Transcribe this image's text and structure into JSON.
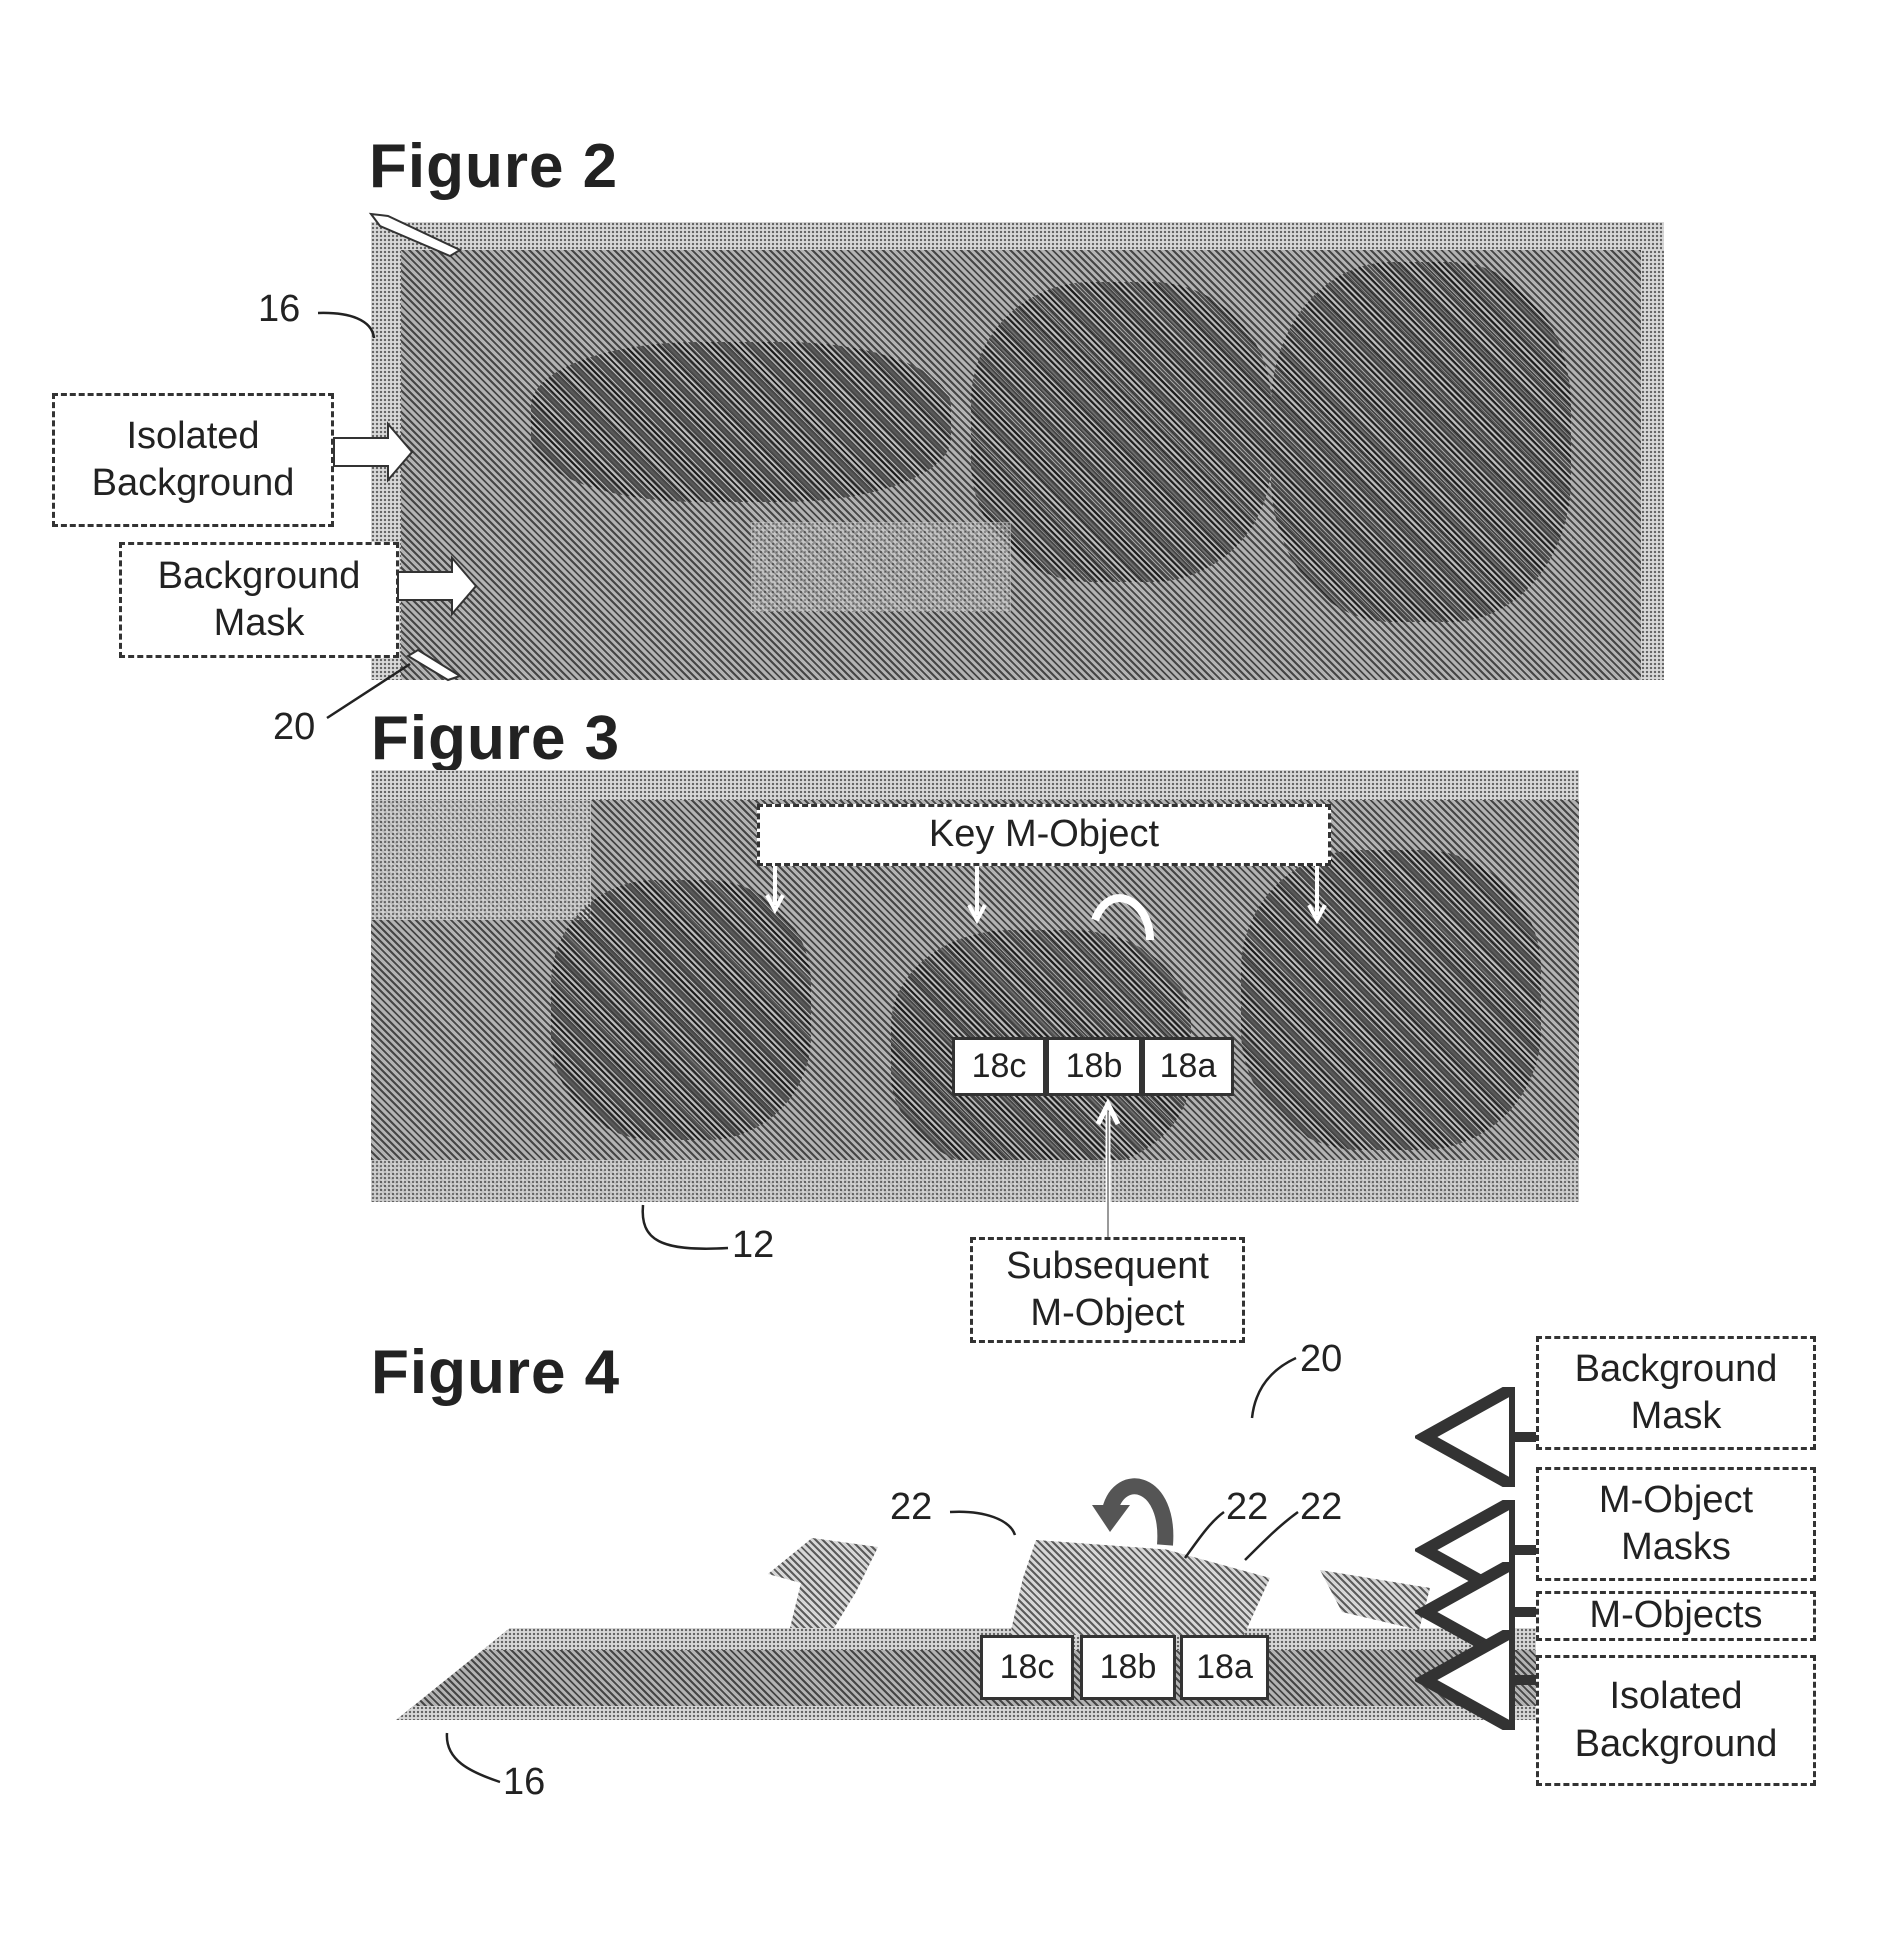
{
  "figure2": {
    "title": "Figure 2",
    "labels": {
      "isolated_background": "Isolated\nBackground",
      "background_mask": "Background\nMask"
    },
    "refs": {
      "layer": "16",
      "mask": "20"
    }
  },
  "figure3": {
    "title": "Figure 3",
    "key_object_label": "Key M-Object",
    "subsequent_object_label": "Subsequent\nM-Object",
    "objects": [
      "18c",
      "18b",
      "18a"
    ],
    "refs": {
      "frame": "12"
    }
  },
  "figure4": {
    "title": "Figure 4",
    "layer_labels": [
      "Background\nMask",
      "M-Object\nMasks",
      "M-Objects",
      "Isolated\nBackground"
    ],
    "objects": [
      "18c",
      "18b",
      "18a"
    ],
    "refs": {
      "mask": "20",
      "object_mask_1": "22",
      "object_mask_2": "22",
      "object_mask_3": "22",
      "background": "16"
    }
  }
}
